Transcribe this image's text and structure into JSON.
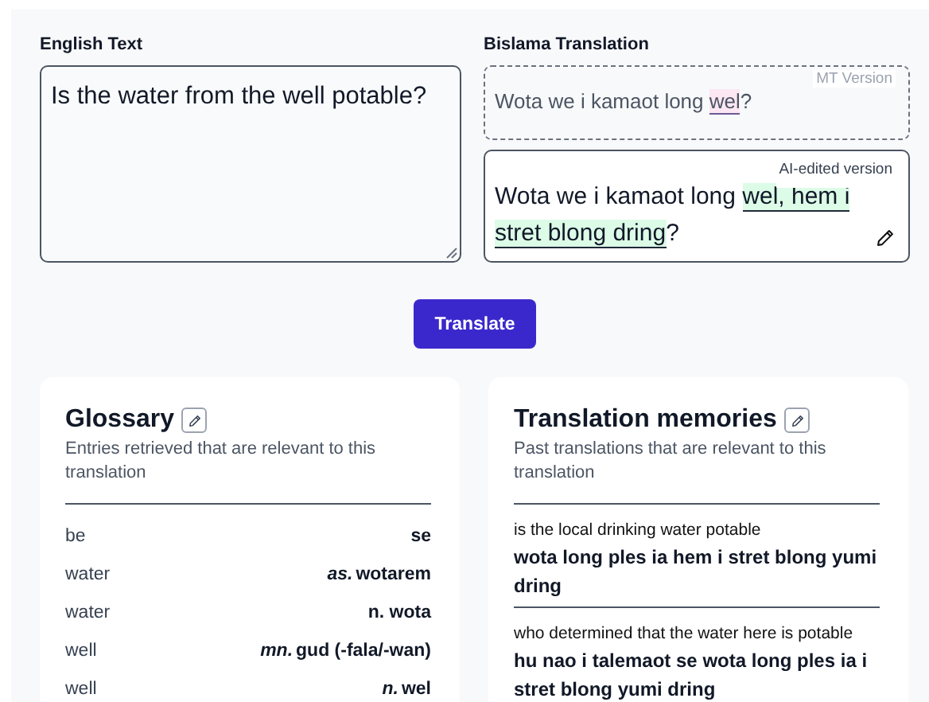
{
  "source": {
    "label": "English Text",
    "value": "Is the water from the well potable?"
  },
  "translation": {
    "label": "Bislama Translation",
    "mt": {
      "tag": "MT Version",
      "segments": [
        {
          "text": "Wota we i kamaot long ",
          "changed": false
        },
        {
          "text": "wel",
          "changed": true
        },
        {
          "text": "?",
          "changed": false
        }
      ]
    },
    "ai": {
      "tag": "AI-edited version",
      "segments": [
        {
          "text": "Wota we i kamaot long ",
          "changed": false
        },
        {
          "text": "wel, hem i stret blong dring",
          "changed": true
        },
        {
          "text": "?",
          "changed": false
        }
      ]
    }
  },
  "translate_button": "Translate",
  "glossary": {
    "title": "Glossary",
    "description": "Entries retrieved that are relevant to this translation",
    "entries": [
      {
        "source": "be",
        "target": "se"
      },
      {
        "source": "water",
        "pos": "as.",
        "target": "wotarem"
      },
      {
        "source": "water",
        "target": "n. wota"
      },
      {
        "source": "well",
        "pos": "mn.",
        "target": "gud (-fala/-wan)"
      },
      {
        "source": "well",
        "pos": "n.",
        "target": "wel"
      }
    ]
  },
  "memories": {
    "title": "Translation memories",
    "description": "Past translations that are relevant to this translation",
    "entries": [
      {
        "source": "is the local drinking water potable",
        "target": "wota long ples ia hem i stret blong yumi dring"
      },
      {
        "source": "who determined that the water here is potable",
        "target": "hu nao i talemaot se wota long ples ia i stret blong yumi dring"
      }
    ]
  }
}
